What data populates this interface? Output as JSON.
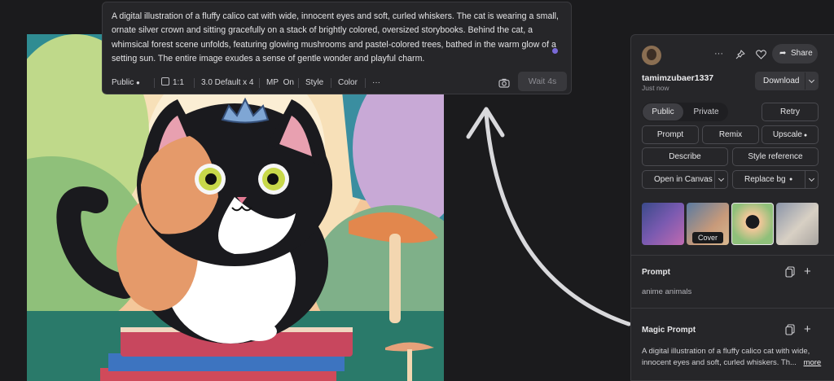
{
  "prompt_popup": {
    "text": "A digital illustration of a fluffy calico cat with wide, innocent eyes and soft, curled whiskers. The cat is wearing a small, ornate silver crown and sitting gracefully on a stack of brightly colored, oversized storybooks. Behind the cat, a whimsical forest scene unfolds, featuring glowing mushrooms and pastel-colored trees, bathed in the warm glow of a setting sun. The entire image exudes a sense of gentle wonder and playful charm.",
    "visibility": "Public",
    "aspect_ratio": "1:1",
    "model": "3.0 Default x 4",
    "mp_label": "MP",
    "mp_value": "On",
    "style": "Style",
    "color": "Color",
    "more": "···",
    "wait_button": "Wait 4s"
  },
  "panel": {
    "username": "tamimzubaer1337",
    "time": "Just now",
    "share": "Share",
    "download": "Download",
    "visibility_toggle": {
      "public": "Public",
      "private": "Private",
      "selected": "Public"
    },
    "actions": {
      "retry": "Retry",
      "prompt": "Prompt",
      "remix": "Remix",
      "upscale": "Upscale",
      "describe": "Describe",
      "style_reference": "Style reference",
      "open_in_canvas": "Open in Canvas",
      "replace_bg": "Replace bg"
    },
    "thumbnail_tooltip": "Cover",
    "prompt_section": {
      "title": "Prompt",
      "text": "anime animals"
    },
    "magic_prompt_section": {
      "title": "Magic Prompt",
      "line1": "A digital illustration of a fluffy calico cat with wide,",
      "line2": "innocent eyes and soft, curled whiskers. Th...",
      "more": "more"
    }
  },
  "colors": {
    "accent": "#7a6ad8",
    "panel_bg": "#262629",
    "page_bg": "#1b1b1d"
  }
}
